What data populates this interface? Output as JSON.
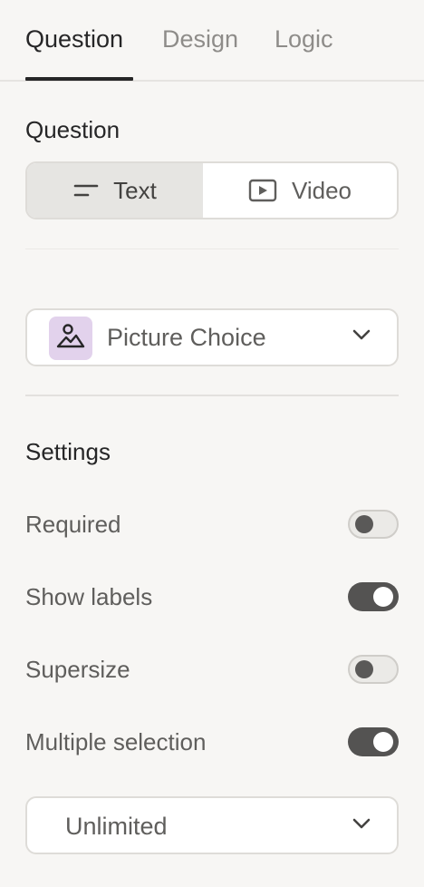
{
  "tabs": [
    {
      "label": "Question",
      "active": true
    },
    {
      "label": "Design",
      "active": false
    },
    {
      "label": "Logic",
      "active": false
    }
  ],
  "question_section": {
    "title": "Question",
    "segments": [
      {
        "label": "Text",
        "icon": "text-lines-icon",
        "selected": true
      },
      {
        "label": "Video",
        "icon": "video-play-icon",
        "selected": false
      }
    ]
  },
  "question_type": {
    "label": "Picture Choice",
    "icon": "picture-choice-icon",
    "badge_color": "#e2d2ec"
  },
  "settings": {
    "title": "Settings",
    "items": [
      {
        "label": "Required",
        "enabled": false
      },
      {
        "label": "Show labels",
        "enabled": true
      },
      {
        "label": "Supersize",
        "enabled": false
      },
      {
        "label": "Multiple selection",
        "enabled": true
      }
    ]
  },
  "selection_limit": {
    "value": "Unlimited"
  },
  "colors": {
    "background": "#f7f6f4",
    "text_primary": "#262627",
    "text_secondary": "#5f5e5c",
    "toggle_on": "#545352"
  }
}
